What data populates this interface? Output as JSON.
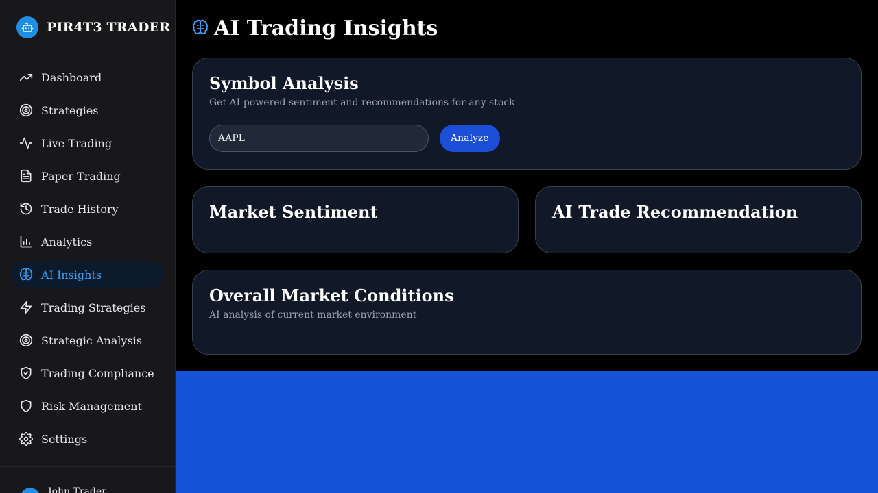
{
  "brand": {
    "title": "PIR4T3 TRADER",
    "icon": "robot-icon"
  },
  "sidebar": {
    "items": [
      {
        "label": "Dashboard",
        "icon": "trending-up-icon"
      },
      {
        "label": "Strategies",
        "icon": "target-icon"
      },
      {
        "label": "Live Trading",
        "icon": "activity-icon"
      },
      {
        "label": "Paper Trading",
        "icon": "file-text-icon"
      },
      {
        "label": "Trade History",
        "icon": "history-icon"
      },
      {
        "label": "Analytics",
        "icon": "bar-chart-icon"
      },
      {
        "label": "AI Insights",
        "icon": "brain-icon",
        "active": true
      },
      {
        "label": "Trading Strategies",
        "icon": "zap-icon"
      },
      {
        "label": "Strategic Analysis",
        "icon": "target-icon"
      },
      {
        "label": "Trading Compliance",
        "icon": "shield-check-icon"
      },
      {
        "label": "Risk Management",
        "icon": "shield-icon"
      },
      {
        "label": "Settings",
        "icon": "gear-icon"
      }
    ]
  },
  "user": {
    "name": "John Trader"
  },
  "page": {
    "title": "AI Trading Insights",
    "icon": "brain-icon"
  },
  "symbol_analysis": {
    "title": "Symbol Analysis",
    "subtitle": "Get AI-powered sentiment and recommendations for any stock",
    "input_value": "AAPL",
    "button_label": "Analyze"
  },
  "market_sentiment": {
    "title": "Market Sentiment"
  },
  "trade_recommendation": {
    "title": "AI Trade Recommendation"
  },
  "overall_conditions": {
    "title": "Overall Market Conditions",
    "subtitle": "AI analysis of current market environment"
  },
  "colors": {
    "accent": "#3b9bf0",
    "button": "#1d4ed8",
    "panel_blue": "#1553d9",
    "card_bg": "#111827",
    "sidebar_bg": "#18181b"
  }
}
